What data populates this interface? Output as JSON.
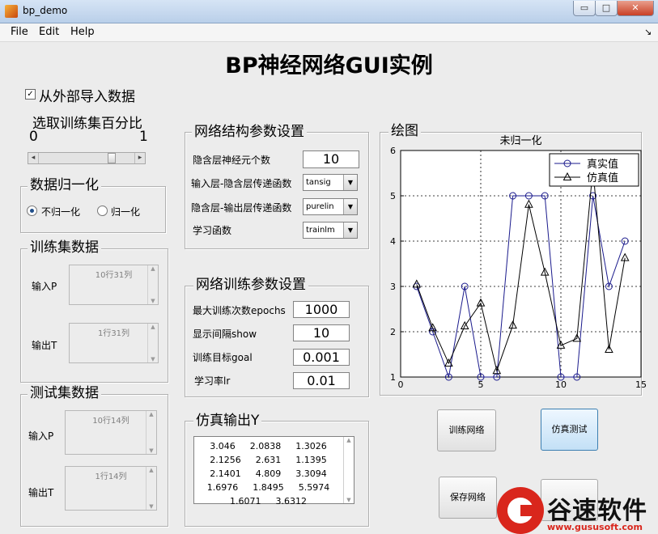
{
  "window": {
    "title": "bp_demo",
    "minimize_glyph": "▭",
    "maximize_glyph": "□",
    "close_glyph": "✕"
  },
  "menu": {
    "file": "File",
    "edit": "Edit",
    "help": "Help",
    "dock_glyph": "↘"
  },
  "heading": "BP神经网络GUI实例",
  "import": {
    "checkbox_label": "从外部导入数据",
    "checked": true,
    "check_glyph": "✓"
  },
  "split": {
    "label": "选取训练集百分比",
    "min": "0",
    "max": "1",
    "slider_value": 0.78,
    "left_arrow": "◂",
    "right_arrow": "▸"
  },
  "normalize": {
    "title": "数据归一化",
    "opt_no": "不归一化",
    "opt_yes": "归一化",
    "selected": "不归一化"
  },
  "train_data": {
    "title": "训练集数据",
    "input_label": "输入P",
    "input_value": "10行31列",
    "output_label": "输出T",
    "output_value": "1行31列"
  },
  "test_data": {
    "title": "测试集数据",
    "input_label": "输入P",
    "input_value": "10行14列",
    "output_label": "输出T",
    "output_value": "1行14列"
  },
  "scroll": {
    "up": "▲",
    "down": "▼"
  },
  "structure": {
    "title": "网络结构参数设置",
    "hidden_label": "隐含层神经元个数",
    "hidden_value": "10",
    "in_hidden_label": "输入层-隐含层传递函数",
    "in_hidden_value": "tansig",
    "hidden_out_label": "隐含层-输出层传递函数",
    "hidden_out_value": "purelin",
    "train_fn_label": "学习函数",
    "train_fn_value": "trainlm",
    "dropdown_glyph": "▼"
  },
  "training": {
    "title": "网络训练参数设置",
    "epochs_label": "最大训练次数epochs",
    "epochs_value": "1000",
    "show_label": "显示间隔show",
    "show_value": "10",
    "goal_label": "训练目标goal",
    "goal_value": "0.001",
    "lr_label": "学习率lr",
    "lr_value": "0.01"
  },
  "sim_output": {
    "title": "仿真输出Y",
    "rows": [
      [
        "3.046",
        "2.0838",
        "1.3026"
      ],
      [
        "2.1256",
        "2.631",
        "1.1395"
      ],
      [
        "2.1401",
        "4.809",
        "3.3094"
      ],
      [
        "1.6976",
        "1.8495",
        "5.5974"
      ],
      [
        "1.6071",
        "3.6312"
      ]
    ]
  },
  "plot_panel": {
    "title": "绘图"
  },
  "buttons": {
    "train": "训练网络",
    "simulate": "仿真测试",
    "save": "保存网络"
  },
  "watermark": {
    "brand": "谷速软件",
    "url": "www.gususoft.com",
    "color": "#d9261c"
  },
  "chart_data": {
    "type": "line",
    "title": "未归一化",
    "xlim": [
      0,
      15
    ],
    "ylim": [
      1,
      6
    ],
    "xticks": [
      0,
      5,
      10,
      15
    ],
    "yticks": [
      1,
      2,
      3,
      4,
      5,
      6
    ],
    "grid": true,
    "legend_position": "top-right",
    "x": [
      1,
      2,
      3,
      4,
      5,
      6,
      7,
      8,
      9,
      10,
      11,
      12,
      13,
      14
    ],
    "series": [
      {
        "name": "真实值",
        "marker": "circle",
        "color": "#1a1a8c",
        "values": [
          3,
          2,
          1,
          3,
          1,
          1,
          5,
          5,
          5,
          1,
          1,
          5,
          3,
          4
        ]
      },
      {
        "name": "仿真值",
        "marker": "triangle",
        "color": "#000000",
        "values": [
          3.046,
          2.0838,
          1.3026,
          2.1256,
          2.631,
          1.1395,
          2.1401,
          4.809,
          3.3094,
          1.6976,
          1.8495,
          5.5974,
          1.6071,
          3.6312
        ]
      }
    ]
  }
}
